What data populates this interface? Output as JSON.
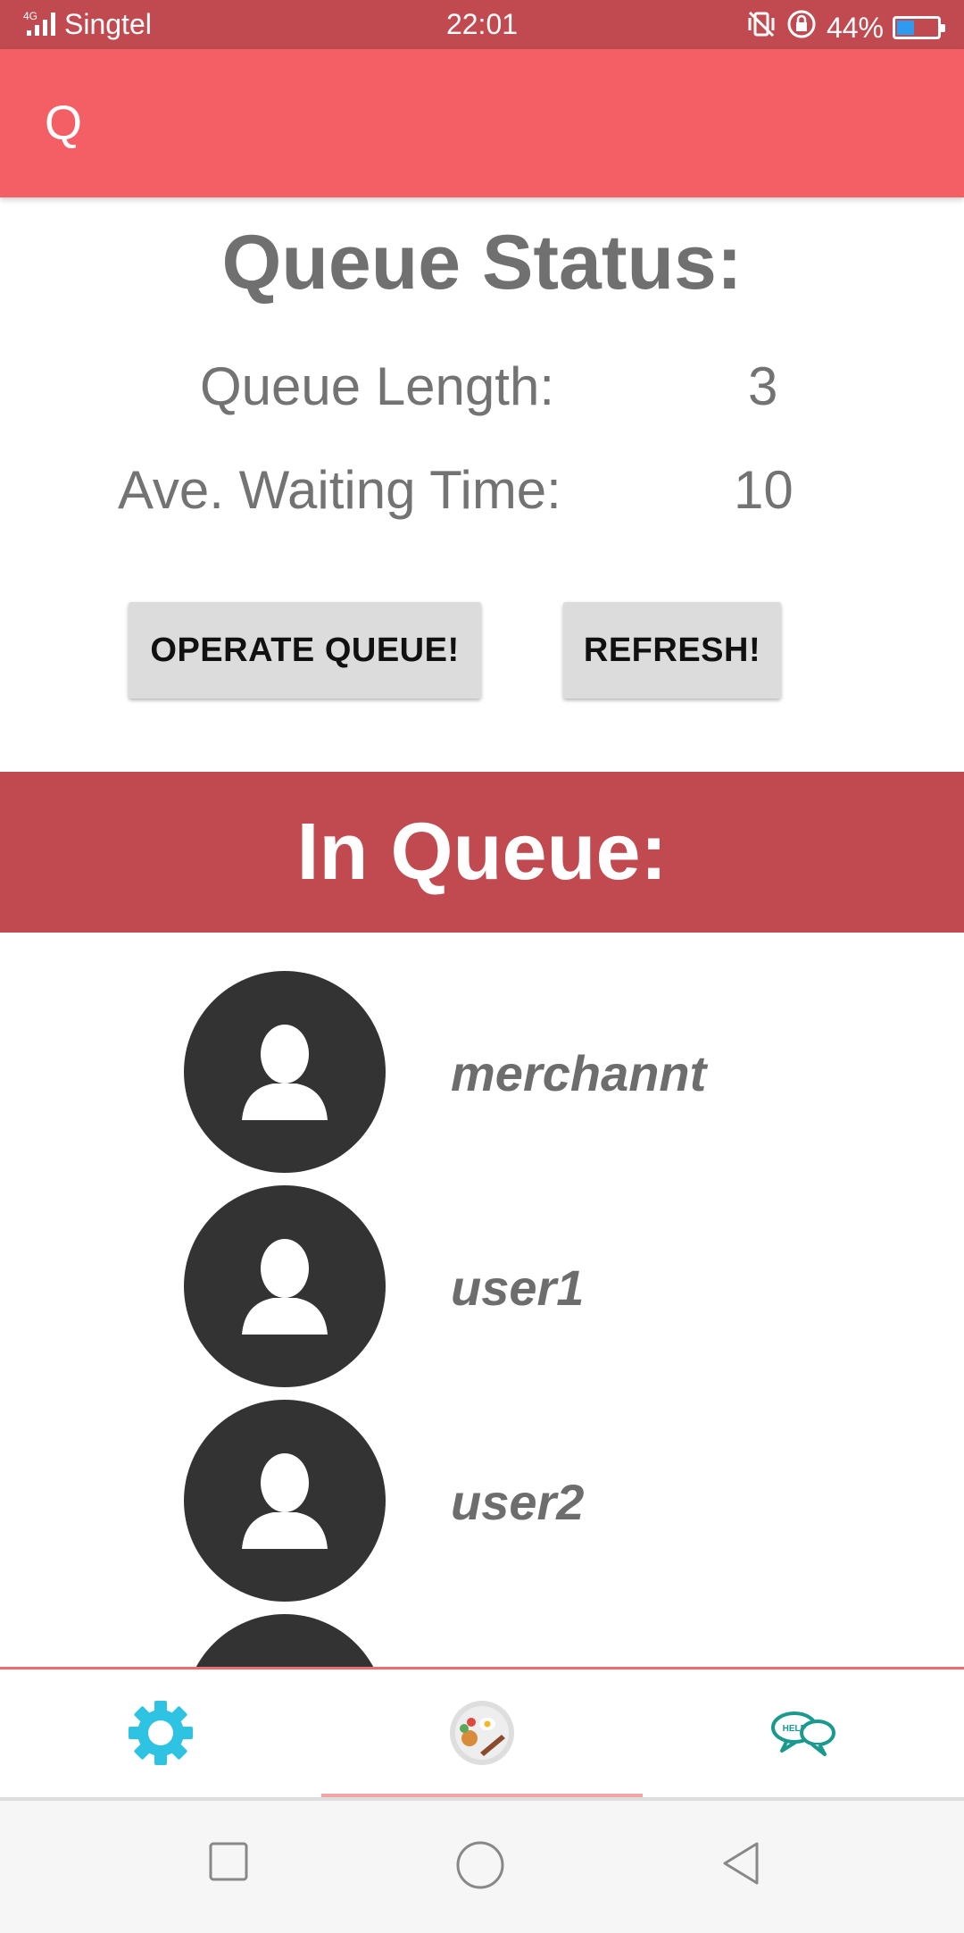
{
  "status_bar": {
    "network": "4G",
    "carrier": "Singtel",
    "time": "22:01",
    "battery": "44%",
    "battery_level": 0.44
  },
  "app_bar": {
    "title": "Q"
  },
  "queue_status": {
    "title": "Queue Status:",
    "length_label": "Queue Length:",
    "length_value": "3",
    "wait_label": "Ave. Waiting Time:",
    "wait_value": "10"
  },
  "buttons": {
    "operate_label": "OPERATE QUEUE!",
    "refresh_label": "REFRESH!"
  },
  "in_queue": {
    "title": "In Queue:",
    "users": [
      {
        "name": "merchannt"
      },
      {
        "name": "user1"
      },
      {
        "name": "user2"
      },
      {
        "name": ""
      }
    ]
  },
  "bottom_nav": {
    "items": [
      {
        "icon": "gear-icon"
      },
      {
        "icon": "food-plate-icon"
      },
      {
        "icon": "help-chat-icon"
      }
    ],
    "selected": "food-plate-icon"
  },
  "colors": {
    "status_bar": "#c04a4f",
    "app_bar": "#f45f66",
    "band": "#c04a4f",
    "gear": "#2ec3e2",
    "help": "#1a9a8e"
  }
}
